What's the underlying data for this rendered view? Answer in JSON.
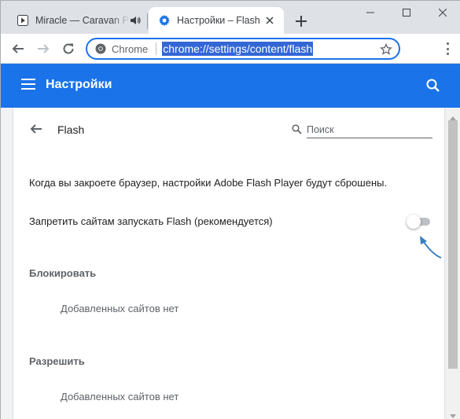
{
  "tabs": [
    {
      "title": "Miracle — Caravan Palace",
      "active": false,
      "audio": true
    },
    {
      "title": "Настройки – Flash",
      "active": true,
      "audio": false
    }
  ],
  "toolbar": {
    "site_label": "Chrome",
    "url": "chrome://settings/content/flash"
  },
  "header": {
    "title": "Настройки"
  },
  "subpage": {
    "title": "Flash",
    "search_placeholder": "Поиск"
  },
  "content": {
    "notice": "Когда вы закроете браузер, настройки Adobe Flash Player будут сброшены.",
    "toggle_label": "Запретить сайтам запускать Flash (рекомендуется)",
    "toggle_on": false,
    "block": {
      "heading": "Блокировать",
      "empty": "Добавленных сайтов нет"
    },
    "allow": {
      "heading": "Разрешить",
      "empty": "Добавленных сайтов нет"
    }
  },
  "colors": {
    "accent": "#1a73e8",
    "arrow": "#3a7fbf"
  },
  "icons": [
    "play-icon",
    "speaker-icon",
    "gear-icon",
    "close-icon",
    "new-tab-icon",
    "minimize-icon",
    "maximize-icon",
    "window-close-icon",
    "back-arrow-icon",
    "forward-arrow-icon",
    "reload-icon",
    "chrome-logo-icon",
    "star-icon",
    "menu-dots-icon",
    "hamburger-icon",
    "search-icon"
  ]
}
